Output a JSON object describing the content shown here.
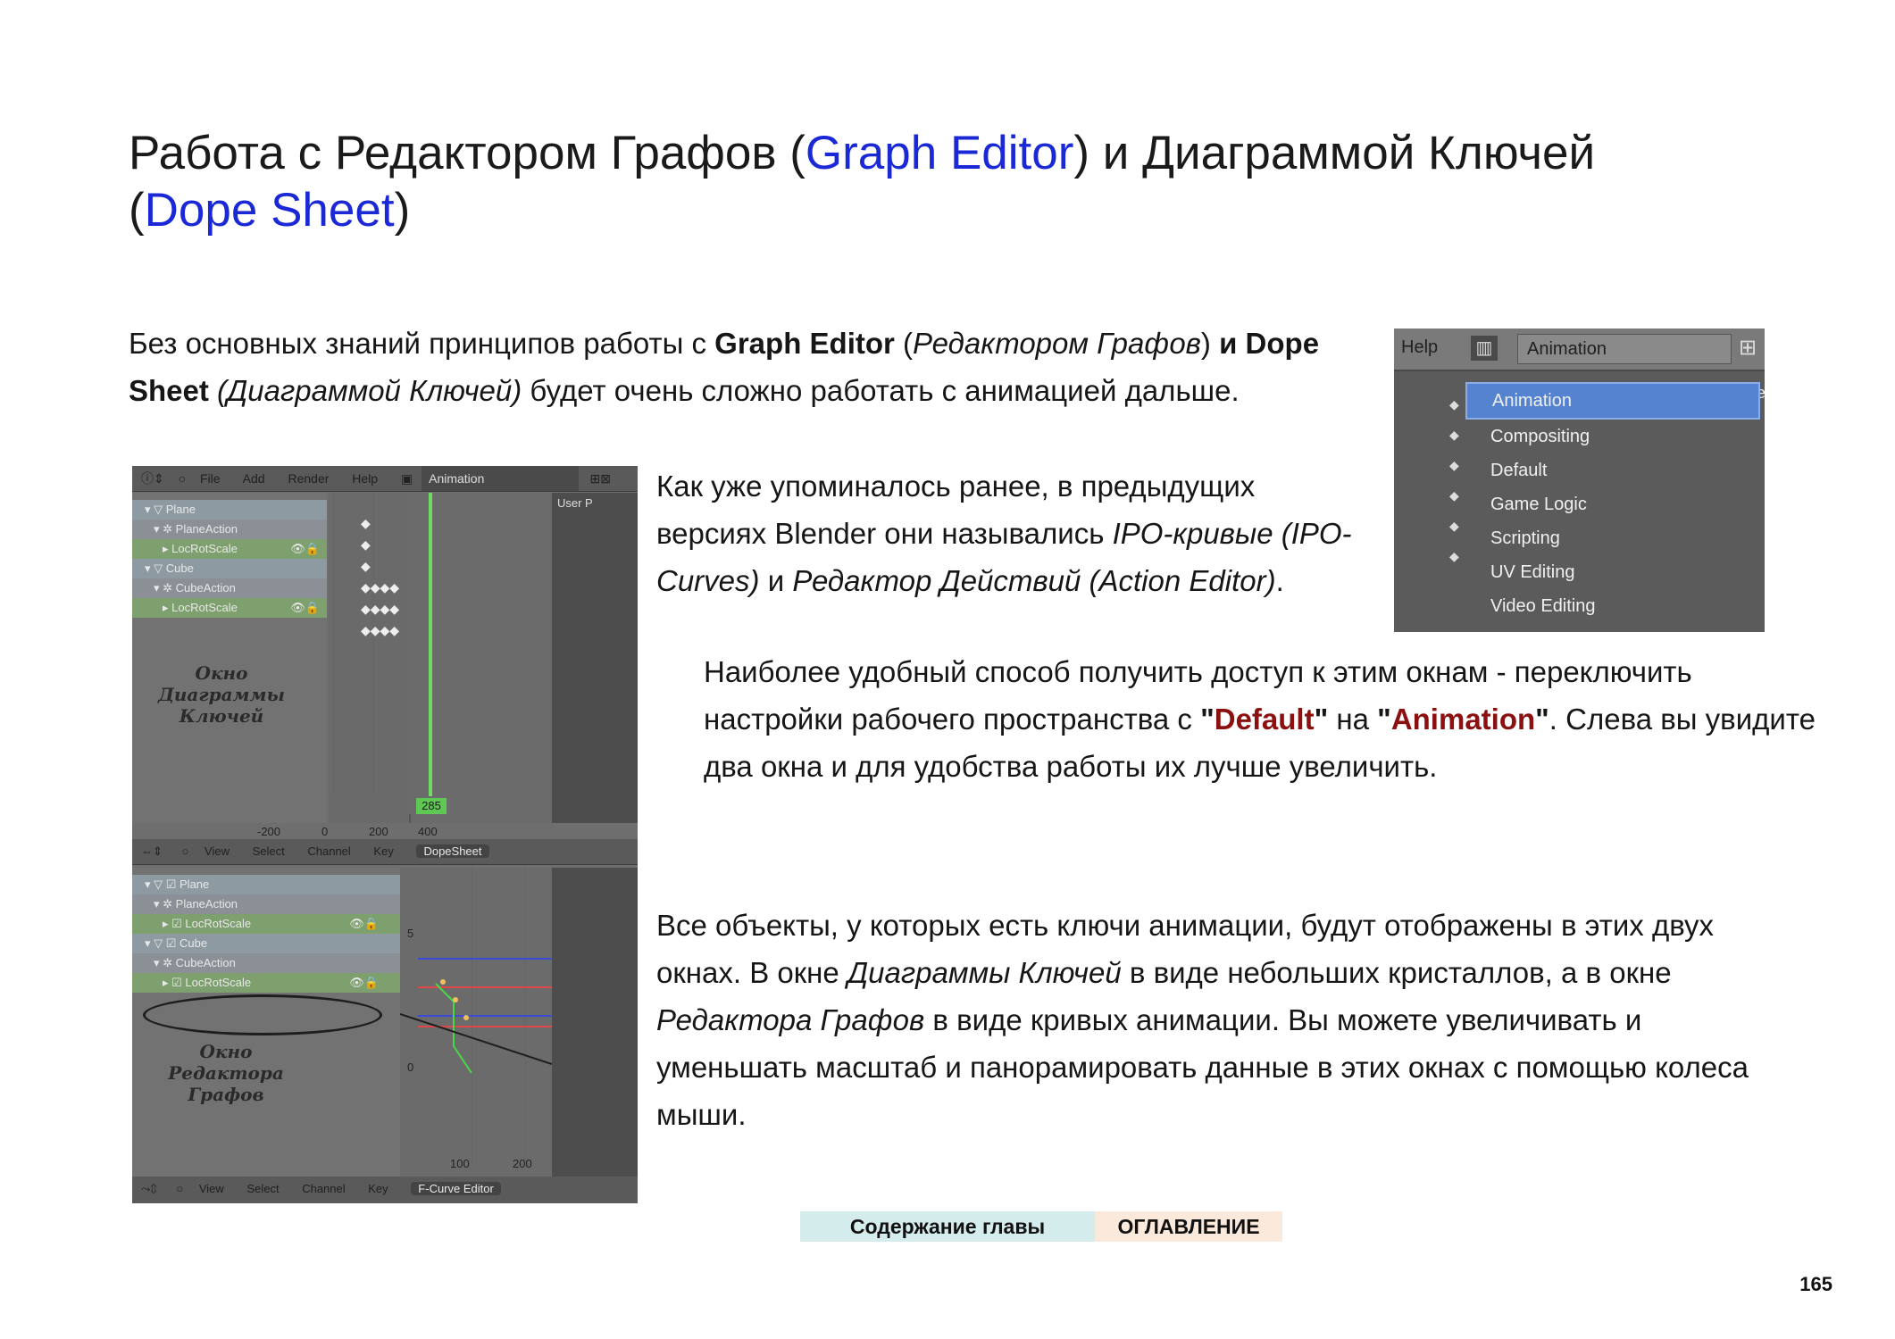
{
  "title": {
    "part1": "Работа с Редактором Графов (",
    "graph_editor": "Graph Editor",
    "part2": ") и Диаграммой Ключей",
    "part3": "(",
    "dope_sheet": "Dope Sheet",
    "part4": ")"
  },
  "intro": {
    "t1": "Без основных знаний принципов работы с ",
    "b1": "Graph Editor",
    "t2": " (",
    "i1": "Редактором Графов",
    "t3": ") ",
    "b2": "и",
    "b3": "Dope Sheet",
    "t4": " ",
    "i2": "(Диаграммой Ключей)",
    "t5": " будет очень сложно работать с анимацией дальше."
  },
  "history": {
    "t1": "Как уже упоминалось ранее, в предыдущих версиях Blender они назывались ",
    "i1": "IPO-кривые (IPO-Curves)",
    "t2": " и ",
    "i2": "Редактор Действий (Action Editor)",
    "t3": "."
  },
  "access": {
    "t1": "Наиболее удобный способ получить доступ к этим окнам - переключить настройки рабочего пространства с ",
    "q1": "\"",
    "default": "Default",
    "q2": "\"",
    "t2": " на ",
    "q3": "\"",
    "animation": "Animation",
    "q4": "\"",
    "t3": ". Слева вы увидите два окна и для удобства работы их лучше увеличить."
  },
  "objects": {
    "t1": "Все объекты, у которых есть ключи анимации, будут отображены в этих двух окнах. В окне ",
    "i1": "Диаграммы Ключей",
    "t2": " в виде небольших кристаллов, а в окне ",
    "i2": "Редактора Графов",
    "t3": " в виде кривых анимации. Вы можете увеличивать и уменьшать масштаб и панорамировать данные в этих окнах с помощью колеса мыши."
  },
  "blender_screenshot": {
    "top_menu": [
      "File",
      "Add",
      "Render",
      "Help"
    ],
    "layout_name": "Animation",
    "user_persp": "User P",
    "dope_channels": [
      "Plane",
      "PlaneAction",
      "LocRotScale",
      "Cube",
      "CubeAction",
      "LocRotScale"
    ],
    "dope_label": [
      "Окно",
      "Диаграммы",
      "Ключей"
    ],
    "frame_current": "285",
    "frame_ticks": [
      "-200",
      "0",
      "200",
      "400"
    ],
    "dope_footer": [
      "View",
      "Select",
      "Channel",
      "Key"
    ],
    "dope_mode": "DopeSheet",
    "graph_channels": [
      "Plane",
      "PlaneAction",
      "LocRotScale",
      "Cube",
      "CubeAction",
      "LocRotScale"
    ],
    "graph_label": [
      "Окно",
      "Редактора",
      "Графов"
    ],
    "graph_ticks": [
      "100",
      "200"
    ],
    "graph_y_ticks": [
      "5",
      "0"
    ],
    "graph_footer": [
      "View",
      "Select",
      "Channel",
      "Key"
    ],
    "graph_mode": "F-Curve Editor"
  },
  "menu_screenshot": {
    "help": "Help",
    "current": "Animation",
    "user": "Use",
    "items": [
      "Animation",
      "Compositing",
      "Default",
      "Game Logic",
      "Scripting",
      "UV Editing",
      "Video Editing"
    ],
    "selected_index": 0
  },
  "footer": {
    "chapter_contents": "Содержание главы",
    "toc": "ОГЛАВЛЕНИЕ",
    "page_number": "165"
  },
  "colors": {
    "title_link": "#1a28d6",
    "keyword_red": "#8b1010",
    "menu_selected": "#5683d0"
  }
}
